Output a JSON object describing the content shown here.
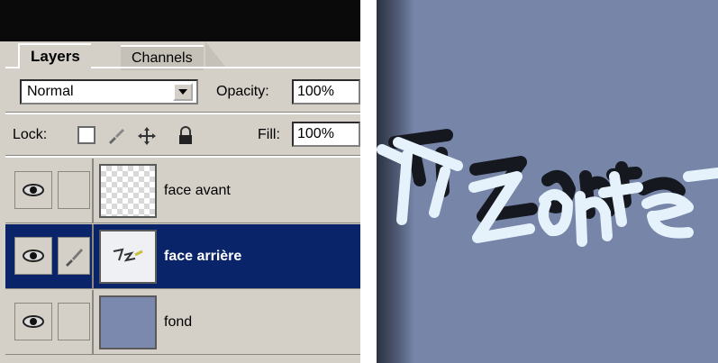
{
  "layers_panel": {
    "tabs": [
      {
        "label": "Layers",
        "active": true
      },
      {
        "label": "Channels",
        "active": false
      }
    ],
    "blend_mode": "Normal",
    "opacity_label": "Opacity:",
    "opacity_value": "100%",
    "lock_label": "Lock:",
    "fill_label": "Fill:",
    "fill_value": "100%",
    "layers": [
      {
        "name": "face avant",
        "visible": true,
        "selected": false,
        "linked": false,
        "thumbnail": "transparent"
      },
      {
        "name": "face arrière",
        "visible": true,
        "selected": true,
        "linked": true,
        "thumbnail": "text"
      },
      {
        "name": "fond",
        "visible": true,
        "selected": false,
        "linked": false,
        "thumbnail": "solid"
      }
    ]
  },
  "canvas": {
    "background_color": "#7685a8",
    "selection_color": "#0a246a",
    "artwork_text": "TZone"
  },
  "icons": {
    "visibility": "eye-icon",
    "brush": "brush-icon",
    "lock_transparent": "checkbox-icon",
    "lock_move": "move-icon",
    "lock_all": "padlock-icon"
  }
}
